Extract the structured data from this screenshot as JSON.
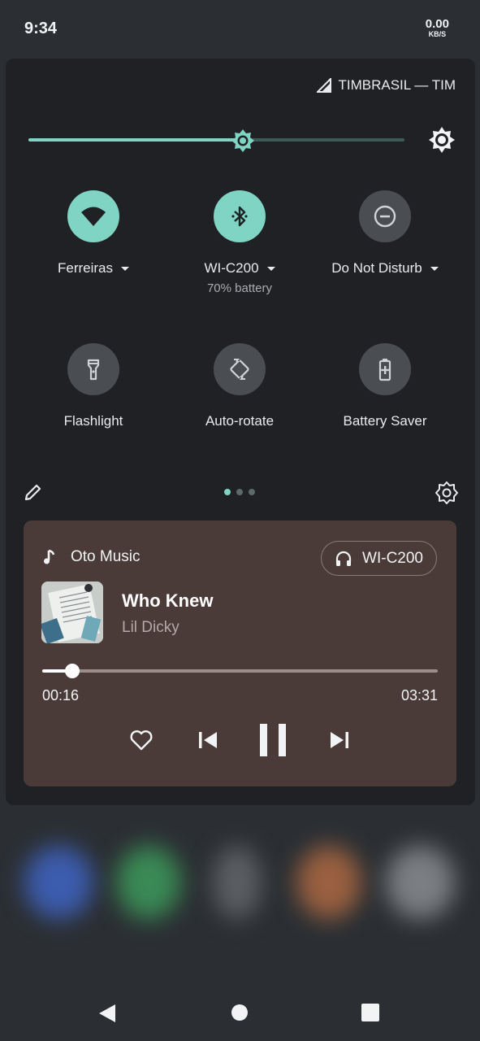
{
  "status": {
    "time": "9:34",
    "net_speed_value": "0.00",
    "net_speed_unit": "KB/S"
  },
  "carrier": {
    "label": "TIMBRASIL — TIM",
    "icon": "signal-icon"
  },
  "brightness": {
    "level": 0.57,
    "settings_icon": "brightness-settings-icon"
  },
  "tiles": [
    {
      "label": "Ferreiras",
      "icon": "wifi-icon",
      "state": "on",
      "has_dropdown": true,
      "sublabel": ""
    },
    {
      "label": "WI-C200",
      "icon": "bluetooth-icon",
      "state": "on",
      "has_dropdown": true,
      "sublabel": "70% battery"
    },
    {
      "label": "Do Not Disturb",
      "icon": "dnd-icon",
      "state": "off",
      "has_dropdown": true,
      "sublabel": ""
    },
    {
      "label": "Flashlight",
      "icon": "flashlight-icon",
      "state": "off",
      "has_dropdown": false,
      "sublabel": ""
    },
    {
      "label": "Auto-rotate",
      "icon": "auto-rotate-icon",
      "state": "off",
      "has_dropdown": false,
      "sublabel": ""
    },
    {
      "label": "Battery Saver",
      "icon": "battery-saver-icon",
      "state": "off",
      "has_dropdown": false,
      "sublabel": ""
    }
  ],
  "qs_footer": {
    "edit_icon": "pencil-icon",
    "settings_icon": "gear-icon",
    "page_count": 3,
    "active_page": 1
  },
  "media": {
    "app_name": "Oto Music",
    "output_device": "WI-C200",
    "title": "Who Knew",
    "artist": "Lil Dicky",
    "position": "00:16",
    "duration": "03:31",
    "progress": 0.076,
    "controls": [
      "heart-icon",
      "skip-previous-icon",
      "pause-icon",
      "skip-next-icon"
    ]
  },
  "colors": {
    "accent": "#7fd4c4",
    "panel": "#202124",
    "media_card": "#4a3b38"
  },
  "nav": {
    "buttons": [
      "back-icon",
      "home-icon",
      "recents-icon"
    ]
  }
}
